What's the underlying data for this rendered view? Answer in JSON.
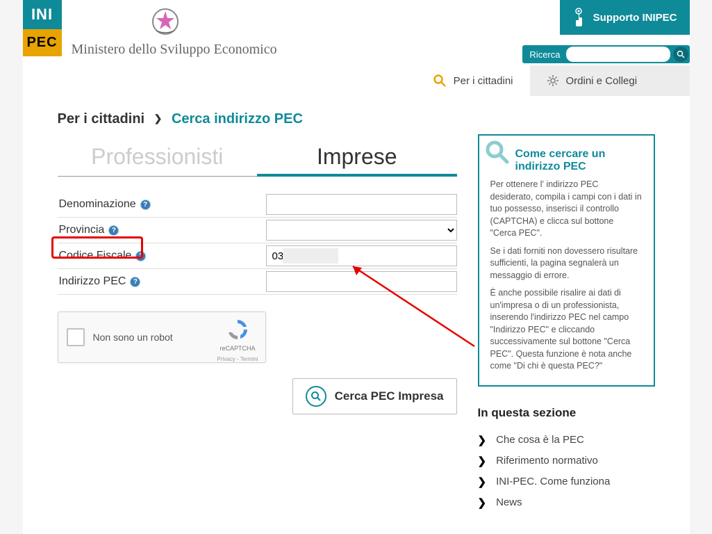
{
  "header": {
    "logo_top": "INI",
    "logo_bottom": "PEC",
    "ministero": "Ministero dello Sviluppo Economico",
    "supporto_label": "Supporto INIPEC",
    "search_label": "Ricerca"
  },
  "nav": {
    "cittadini": "Per i cittadini",
    "ordini": "Ordini e Collegi"
  },
  "breadcrumb": {
    "root": "Per i cittadini",
    "current": "Cerca indirizzo PEC"
  },
  "tabs": {
    "professionisti": "Professionisti",
    "imprese": "Imprese"
  },
  "form": {
    "denominazione_label": "Denominazione",
    "denominazione_value": "",
    "provincia_label": "Provincia",
    "codice_fiscale_label": "Codice Fiscale",
    "codice_fiscale_value": "03",
    "indirizzo_pec_label": "Indirizzo PEC",
    "indirizzo_pec_value": ""
  },
  "recaptcha": {
    "label": "Non sono un robot",
    "brand": "reCAPTCHA",
    "terms": "Privacy - Termini"
  },
  "submit": {
    "label": "Cerca PEC Impresa"
  },
  "infobox": {
    "title": "Come cercare un indirizzo PEC",
    "p1": "Per ottenere l' indirizzo PEC desiderato, compila i campi con i dati in tuo possesso, inserisci il controllo (CAPTCHA) e clicca sul bottone \"Cerca PEC\".",
    "p2": "Se i dati forniti non dovessero risultare sufficienti, la pagina segnalerà un messaggio di errore.",
    "p3": "È anche possibile risalire ai dati di un'impresa o di un professionista, inserendo l'indirizzo PEC nel campo \"Indirizzo PEC\" e cliccando successivamente  sul bottone \"Cerca PEC\". Questa funzione è nota anche come \"Di chi è questa PEC?\""
  },
  "sidebar": {
    "section_title": "In questa sezione",
    "items": [
      {
        "label": "Che cosa è la PEC"
      },
      {
        "label": "Riferimento normativo"
      },
      {
        "label": "INI-PEC. Come funziona"
      },
      {
        "label": "News"
      }
    ]
  },
  "colors": {
    "brand_teal": "#0f8a99",
    "brand_yellow": "#e8a300",
    "highlight_red": "#e60000"
  }
}
